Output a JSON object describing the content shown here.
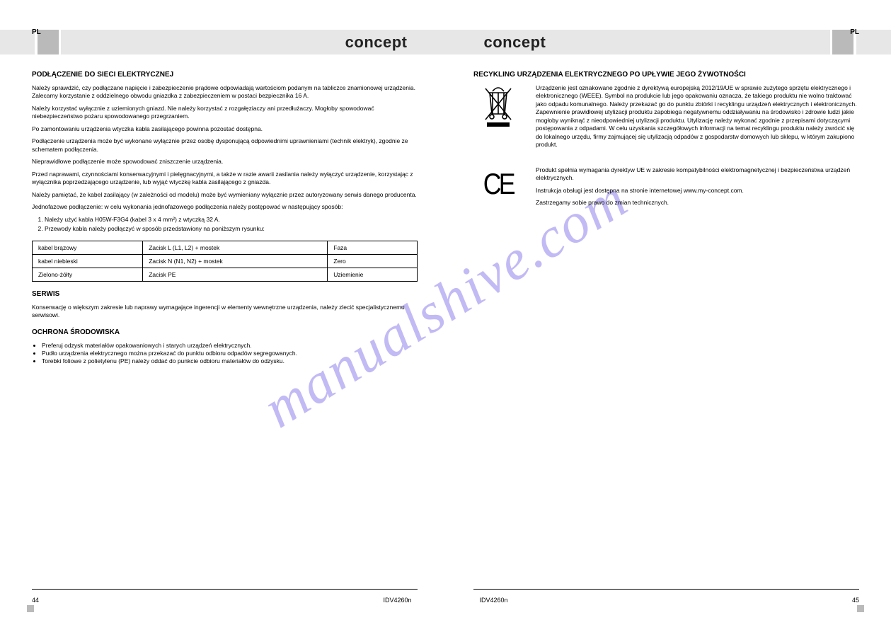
{
  "brand": "concept",
  "lang_tag": "PL",
  "watermark": "manualshive.com",
  "left": {
    "install_heading": "PODŁĄCZENIE DO SIECI ELEKTRYCZNEJ",
    "install_p1": "Należy sprawdzić, czy podłączane napięcie i zabezpieczenie prądowe odpowiadają wartościom podanym na tabliczce znamionowej urządzenia. Zalecamy korzystanie z oddzielnego obwodu gniazdka z zabezpieczeniem w postaci bezpiecznika 16 A.",
    "install_p2": "Należy korzystać wyłącznie z uziemionych gniazd. Nie należy korzystać z rozgałęziaczy ani przedłużaczy. Mogłoby spowodować niebezpieczeństwo pożaru spowodowanego przegrzaniem.",
    "install_p3": "Po zamontowaniu urządzenia wtyczka kabla zasilającego powinna pozostać dostępna.",
    "install_p4": "Podłączenie urządzenia może być wykonane wyłącznie przez osobę dysponującą odpowiednimi uprawnieniami (technik elektryk), zgodnie ze schematem podłączenia.",
    "install_p5": "Nieprawidłowe podłączenie może spowodować zniszczenie urządzenia.",
    "install_p6": "Przed naprawami, czynnościami konserwacyjnymi i pielęgnacyjnymi, a także w razie awarii zasilania należy wyłączyć urządzenie, korzystając z wyłącznika poprzedzającego urządzenie, lub wyjąć wtyczkę kabla zasilającego z gniazda.",
    "install_p7": "Należy pamiętać, że kabel zasilający (w zależności od modelu) może być wymieniany wyłącznie przez autoryzowany serwis danego producenta.",
    "install_p8": "Jednofazowe podłączenie: w celu wykonania jednofazowego podłączenia należy postępować w następujący sposób:",
    "install_list": [
      "Należy użyć kabla H05W-F3G4 (kabel 3 x 4 mm²) z wtyczką 32 A.",
      "Przewody kabla należy podłączyć w sposób przedstawiony na poniższym rysunku:"
    ],
    "table": {
      "rows": [
        [
          "kabel brązowy",
          "Zacisk L (L1, L2) + mostek",
          "Faza"
        ],
        [
          "kabel niebieski",
          "Zacisk N (N1, N2) + mostek",
          "Zero"
        ],
        [
          "Zielono-żółty",
          "Zacisk PE",
          "Uziemienie"
        ]
      ]
    },
    "service_heading": "SERWIS",
    "service_p1": "Konserwację o większym zakresie lub naprawy wymagające ingerencji w elementy wewnętrzne urządzenia, należy zlecić specjalistycznemu serwisowi.",
    "env_heading": "OCHRONA ŚRODOWISKA",
    "env_list": [
      "Preferuj odzysk materiałów opakowaniowych i starych urządzeń elektrycznych.",
      "Pudło urządzenia elektrycznego można przekazać do punktu odbioru odpadów segregowanych.",
      "Torebki foliowe z polietylenu (PE) należy oddać do punkcie odbioru materiałów do odzysku."
    ]
  },
  "right": {
    "recycle_heading": "RECYKLING URZĄDZENIA ELEKTRYCZNEGO PO UPŁYWIE JEGO ŻYWOTNOŚCI",
    "recycle_text": "Urządzenie jest oznakowane zgodnie z dyrektywą europejską 2012/19/UE w sprawie zużytego sprzętu elektrycznego i elektronicznego (WEEE). Symbol na produkcie lub jego opakowaniu oznacza, że takiego produktu nie wolno traktować jako odpadu komunalnego. Należy przekazać go do punktu zbiórki i recyklingu urządzeń elektrycznych i elektronicznych. Zapewnienie prawidłowej utylizacji produktu zapobiega negatywnemu oddziaływaniu na środowisko i zdrowie ludzi jakie mogłoby wyniknąć z nieodpowiedniej utylizacji produktu. Utylizację należy wykonać zgodnie z przepisami dotyczącymi postępowania z odpadami. W celu uzyskania szczegółowych informacji na temat recyklingu produktu należy zwrócić się do lokalnego urzędu, firmy zajmującej się utylizacją odpadów z gospodarstw domowych lub sklepu, w którym zakupiono produkt.",
    "ce_text": "Produkt spełnia wymagania dyrektyw UE w zakresie kompatybilności elektromagnetycznej i bezpieczeństwa urządzeń elektrycznych.",
    "manual_text": "Instrukcja obsługi jest dostępna na stronie internetowej www.my-concept.com.",
    "reserve_text": "Zastrzegamy sobie prawo do zmian technicznych."
  },
  "footer": {
    "model": "IDV4260n",
    "page_left": "44",
    "page_right": "45"
  }
}
